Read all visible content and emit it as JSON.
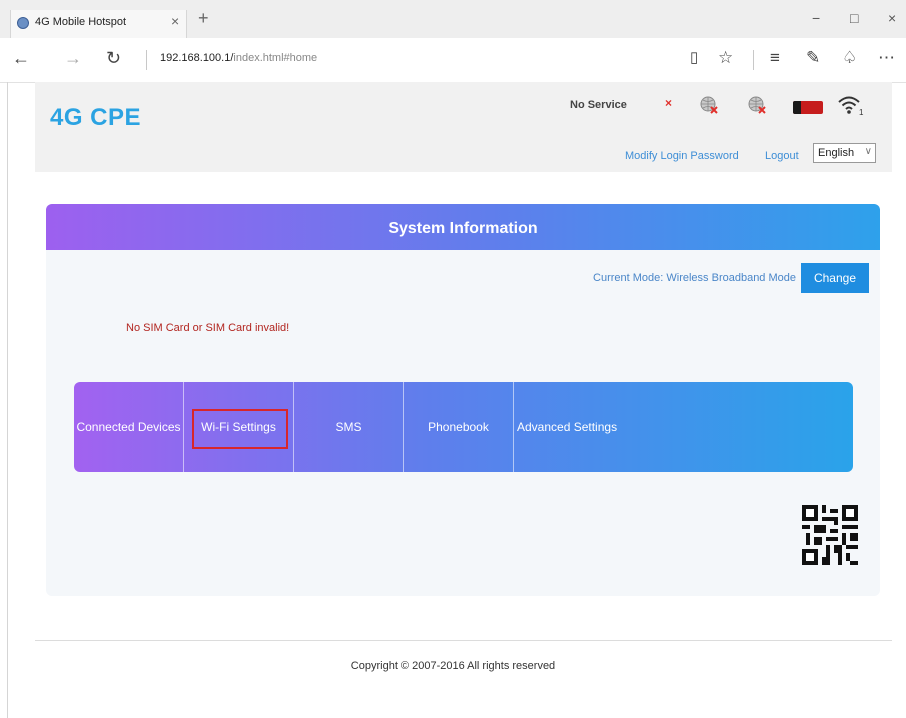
{
  "browser": {
    "tab_title": "4G Mobile Hotspot",
    "tab_close": "×",
    "new_tab": "+",
    "url_host": "192.168.100.1/",
    "url_rest": "index.html#home",
    "window_controls": [
      "−",
      "□",
      "×"
    ],
    "icons": [
      "back-arrow-icon",
      "forward-arrow-icon",
      "refresh-icon",
      "reading-view-icon",
      "favorite-star-icon",
      "hub-icon",
      "web-note-icon",
      "share-icon",
      "more-icon"
    ]
  },
  "header": {
    "brand": "4G CPE",
    "status_text": "No Service",
    "status_x": "×",
    "modify_password": "Modify Login Password",
    "logout": "Logout",
    "language": "English",
    "accent_color": "#2ba3e2"
  },
  "panel": {
    "title": "System Information",
    "current_mode": "Current Mode: Wireless Broadband Mode",
    "change_button": "Change",
    "sim_warning": "No SIM Card or SIM Card invalid!",
    "menu": [
      {
        "label": "Connected Devices"
      },
      {
        "label": "Wi-Fi Settings"
      },
      {
        "label": "SMS"
      },
      {
        "label": "Phonebook"
      },
      {
        "label": "Advanced Settings"
      }
    ]
  },
  "footer": {
    "copyright": "Copyright © 2007-2016 All rights reserved"
  }
}
